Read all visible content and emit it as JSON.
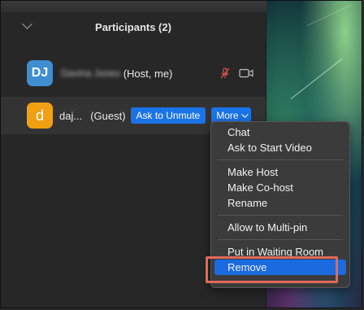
{
  "panel": {
    "title": "Participants (2)"
  },
  "participants": [
    {
      "initials": "DJ",
      "name_blurred": "Davina Jones",
      "role": "(Host, me)",
      "avatar_color": "#3e8ed0"
    },
    {
      "initials": "d",
      "name": "daj...",
      "role": "(Guest)",
      "avatar_color": "#f0a013",
      "ask_to_unmute_label": "Ask to Unmute",
      "more_label": "More"
    }
  ],
  "menu": {
    "items": [
      "Chat",
      "Ask to Start Video",
      "Make Host",
      "Make Co-host",
      "Rename",
      "Allow to Multi-pin",
      "Put in Waiting Room",
      "Remove"
    ],
    "highlighted": "Remove"
  },
  "colors": {
    "accent": "#1a73e8",
    "highlight_box": "#e06a5a",
    "muted_mic": "#d9534f"
  }
}
